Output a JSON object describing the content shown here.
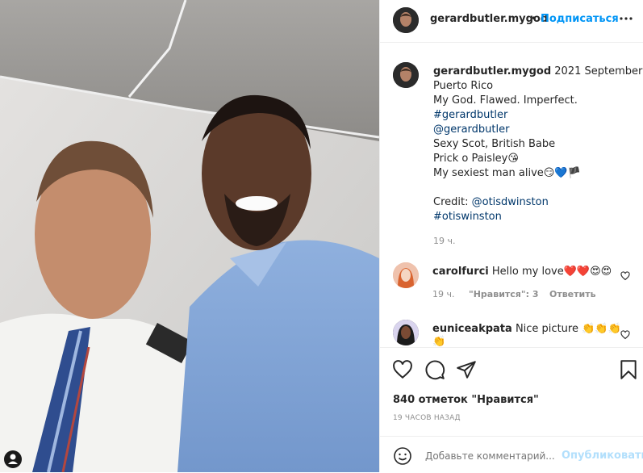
{
  "colors": {
    "link": "#00376b",
    "accent": "#0095f6",
    "muted": "#8e8e8e",
    "text": "#262626"
  },
  "post": {
    "username": "gerardbutler.mygod",
    "dot": "•",
    "follow_label": "Подписаться",
    "more_icon": "more-horizontal-icon"
  },
  "caption": {
    "username": "gerardbutler.mygod",
    "lines": [
      "2021 September",
      "Puerto Rico",
      "My God. Flawed. Imperfect.",
      "#gerardbutler",
      "@gerardbutler",
      "Sexy Scot, British Babe",
      "Prick o Paisley😘",
      "My sexiest man alive😏💙🏴",
      "",
      "Credit: @otisdwinston",
      "#otiswinston"
    ],
    "time": "19 ч."
  },
  "comments": [
    {
      "username": "carolfurci",
      "text": "Hello my love❤️❤️😍😍",
      "time": "19 ч.",
      "likes": "\"Нравится\": 3",
      "reply": "Ответить"
    },
    {
      "username": "euniceakpata",
      "text": "Nice picture 👏👏👏",
      "extra": "👏"
    }
  ],
  "actions": {
    "likes_text": "840 отметок \"Нравится\"",
    "time_ago": "19 ЧАСОВ НАЗАД"
  },
  "add_comment": {
    "placeholder": "Добавьте комментарий...",
    "publish_label": "Опубликовать"
  }
}
